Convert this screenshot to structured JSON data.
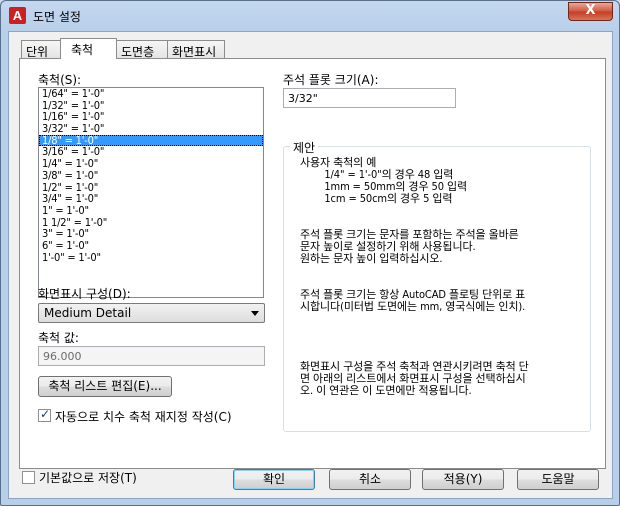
{
  "window": {
    "title": "도면 설정",
    "close_glyph": "X"
  },
  "tabs": [
    "단위",
    "축척",
    "도면층",
    "화면표시"
  ],
  "scale": {
    "label": "축척(S):",
    "items": [
      "1/64\" = 1'-0\"",
      "1/32\" = 1'-0\"",
      "1/16\" = 1'-0\"",
      "3/32\" = 1'-0\"",
      "1/8\" = 1'-0\"",
      "3/16\" = 1'-0\"",
      "1/4\" = 1'-0\"",
      "3/8\" = 1'-0\"",
      "1/2\" = 1'-0\"",
      "3/4\" = 1'-0\"",
      "1\" = 1'-0\"",
      "1 1/2\" = 1'-0\"",
      "3\" = 1'-0\"",
      "6\" = 1'-0\"",
      "1'-0\" = 1'-0\""
    ],
    "selected_index": 4
  },
  "display_config": {
    "label": "화면표시 구성(D):",
    "value": "Medium Detail"
  },
  "scale_value": {
    "label": "축척 값:",
    "value": "96.000"
  },
  "edit_scale_list_button": "축척 리스트 편집(E)...",
  "auto_rescale": {
    "label": "자동으로 치수 축척 재지정 작성(C)",
    "checked": true
  },
  "annotation_plot_size": {
    "label": "주석 플롯 크기(A):",
    "value": "3/32\""
  },
  "hint_group": {
    "title": "제안",
    "lines": [
      "사용자 축척의 예",
      "        1/4\" = 1'-0\"의 경우 48 입력",
      "        1mm = 50mm의 경우 50 입력",
      "        1cm = 50cm의 경우 5 입력",
      "",
      "",
      "주석 플롯 크기는 문자를 포함하는 주석을 올바른",
      "문자 높이로 설정하기 위해 사용됩니다.",
      "원하는 문자 높이 입력하십시오.",
      "",
      "",
      "주석 플롯 크기는 항상 AutoCAD 플로팅 단위로 표",
      "시합니다(미터법 도면에는 mm, 영국식에는 인치).",
      "",
      "",
      "",
      "",
      "화면표시 구성을 주석 축척과 연관시키려면 축척 단",
      "면 아래의 리스트에서 화면표시 구성을 선택하십시",
      "오. 이 연관은 이 도면에만 적용됩니다."
    ]
  },
  "save_default": {
    "label": "기본값으로 저장(T)",
    "checked": false
  },
  "buttons": {
    "ok": "확인",
    "cancel": "취소",
    "apply": "적용(Y)",
    "help": "도움말"
  }
}
